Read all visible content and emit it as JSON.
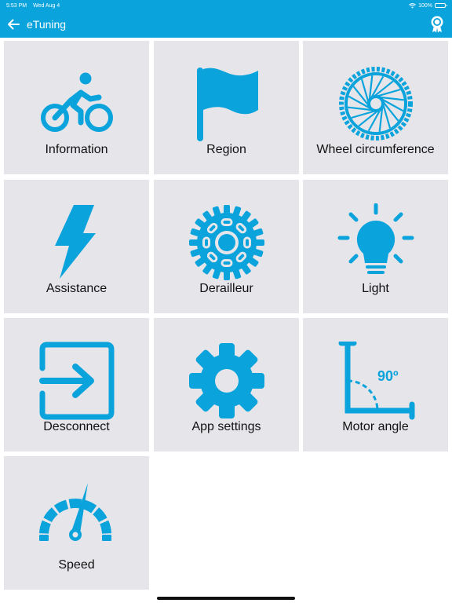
{
  "status_bar": {
    "time": "5:53 PM",
    "date": "Wed Aug 4",
    "battery": "100%",
    "battery_level": 1.0
  },
  "nav": {
    "title": "eTuning"
  },
  "colors": {
    "accent": "#0aa3dc",
    "tile_background": "#e6e6ea",
    "text": "#111111"
  },
  "tiles": [
    {
      "label": "Information",
      "icon": "bicycle-rider-icon"
    },
    {
      "label": "Region",
      "icon": "flag-icon"
    },
    {
      "label": "Wheel circumference",
      "icon": "wheel-icon"
    },
    {
      "label": "Assistance",
      "icon": "lightning-bolt-icon"
    },
    {
      "label": "Derailleur",
      "icon": "chainring-icon"
    },
    {
      "label": "Light",
      "icon": "light-bulb-icon"
    },
    {
      "label": "Desconnect",
      "icon": "exit-icon"
    },
    {
      "label": "App settings",
      "icon": "gear-icon"
    },
    {
      "label": "Motor angle",
      "icon": "angle-icon",
      "angle_text": "90º"
    },
    {
      "label": "Speed",
      "icon": "speedometer-icon"
    }
  ]
}
